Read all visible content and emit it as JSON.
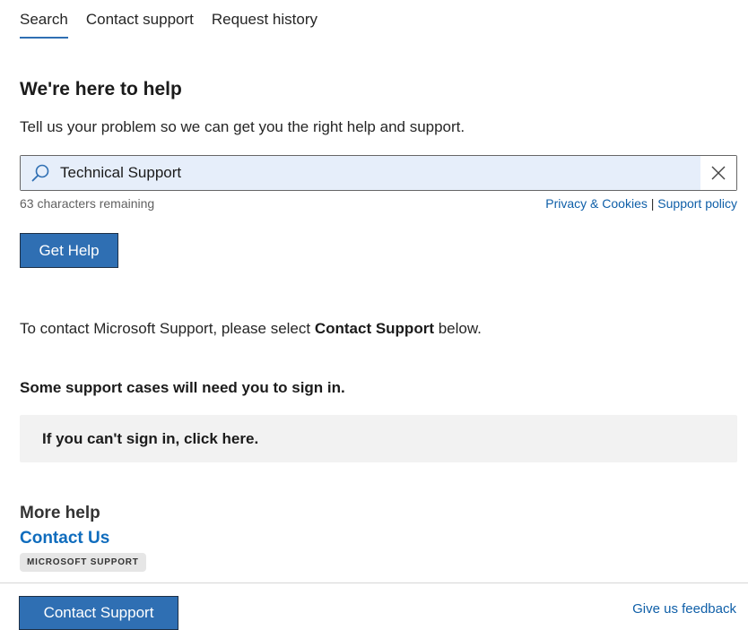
{
  "tabs": [
    {
      "label": "Search",
      "active": true
    },
    {
      "label": "Contact support",
      "active": false
    },
    {
      "label": "Request history",
      "active": false
    }
  ],
  "main": {
    "heading": "We're here to help",
    "subtext": "Tell us your problem so we can get you the right help and support.",
    "search": {
      "value": "Technical Support",
      "icon": "search-icon",
      "clear_icon": "close-icon"
    },
    "chars_remaining": "63 characters remaining",
    "privacy_link": "Privacy & Cookies",
    "separator": "|",
    "support_policy_link": "Support policy",
    "get_help_label": "Get Help",
    "contact_prefix": "To contact Microsoft Support, please select ",
    "contact_bold": "Contact Support",
    "contact_suffix": " below.",
    "signin_note": "Some support cases will need you to sign in.",
    "signin_box": "If you can't sign in, click here."
  },
  "more_help": {
    "title": "More help",
    "contact_us": "Contact Us",
    "badge": "MICROSOFT SUPPORT"
  },
  "footer": {
    "contact_support_label": "Contact Support",
    "feedback_link": "Give us feedback"
  },
  "colors": {
    "accent": "#2f6fb3",
    "link": "#0f5fa8",
    "search_bg": "#e6eefa"
  }
}
